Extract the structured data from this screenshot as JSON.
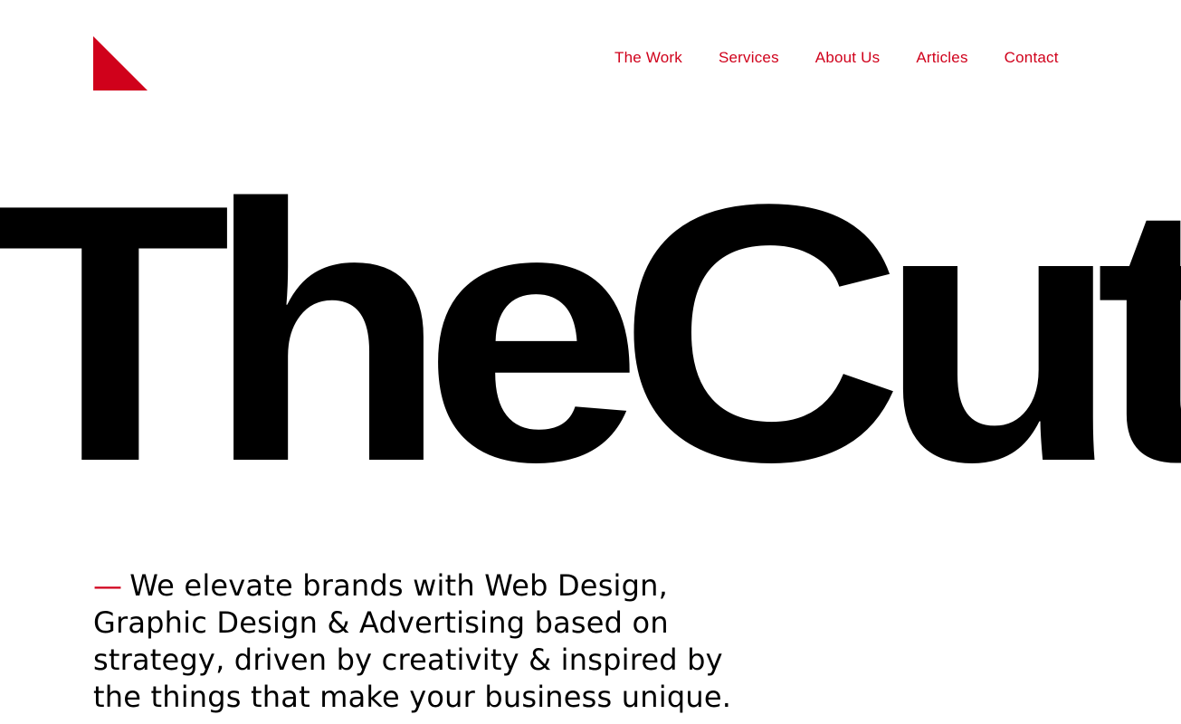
{
  "brand": {
    "logo_icon": "red-triangle-logo",
    "accent_color": "#d0011b",
    "text_color": "#000000",
    "background_color": "#ffffff"
  },
  "nav": {
    "items": [
      {
        "label": "The Work"
      },
      {
        "label": "Services"
      },
      {
        "label": "About Us"
      },
      {
        "label": "Articles"
      },
      {
        "label": "Contact"
      }
    ]
  },
  "hero": {
    "wordmark": "TheCut"
  },
  "intro": {
    "dash": "—",
    "text": "We elevate brands with Web Design, Graphic Design & Advertising based on strategy, driven by creativity & inspired by the things that make your business unique."
  }
}
